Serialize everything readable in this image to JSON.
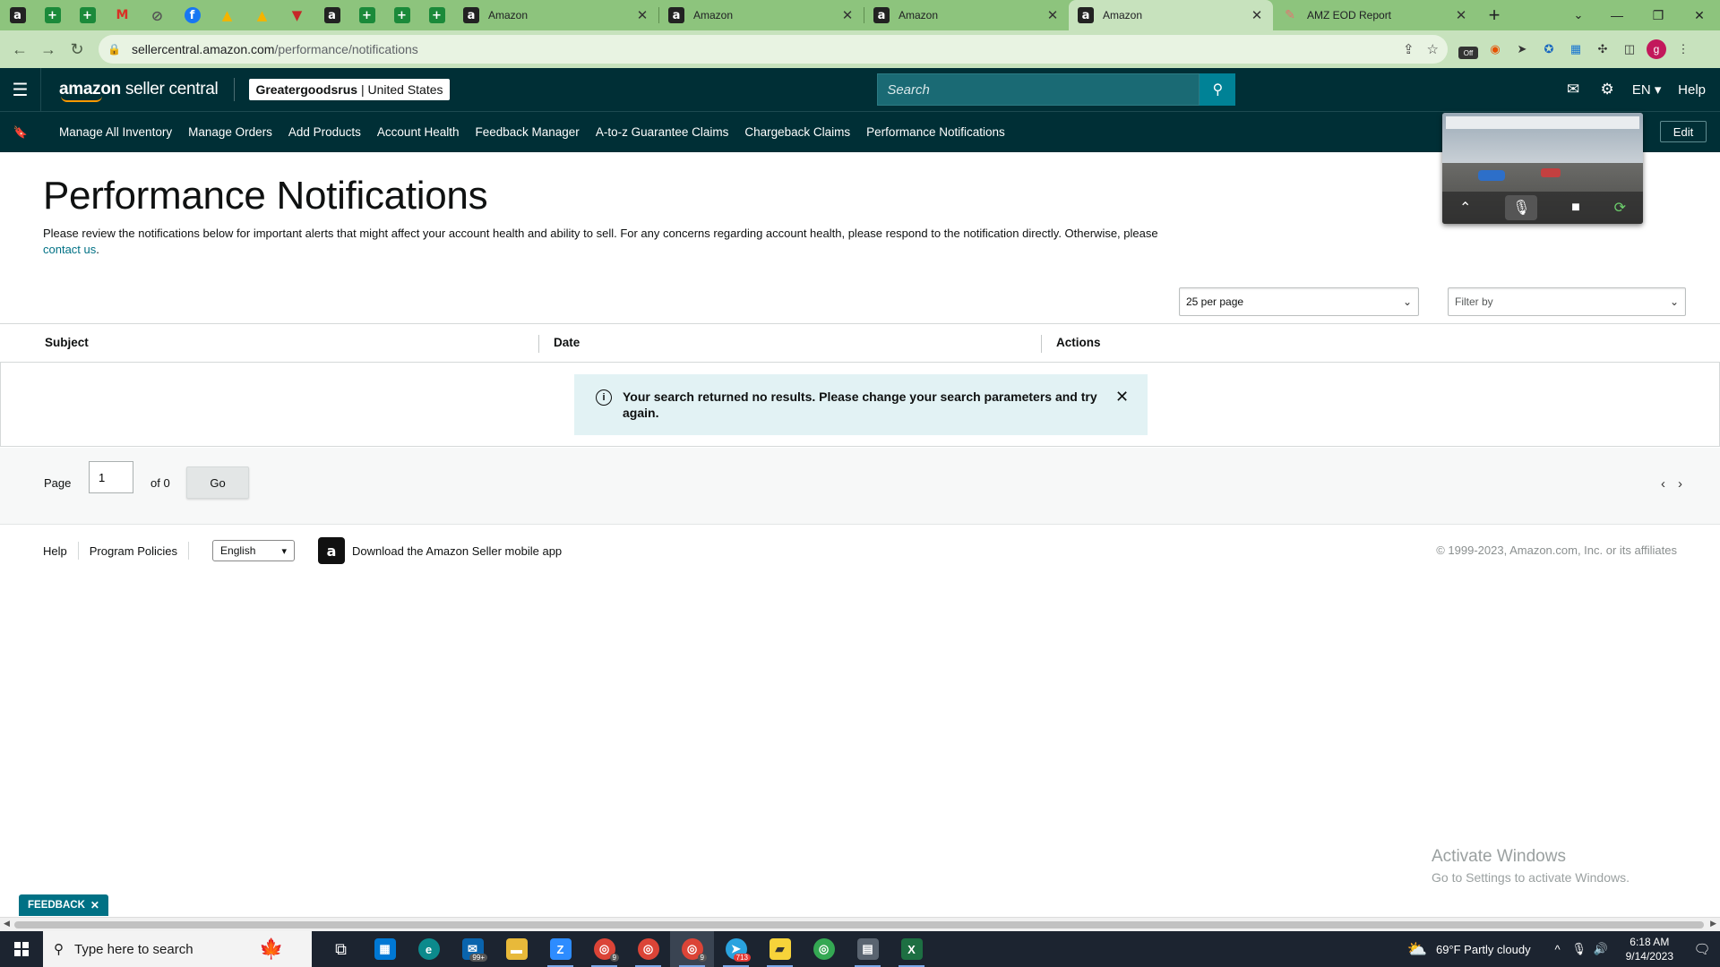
{
  "browser": {
    "pinned_tabs": [
      {
        "icon": "amazon-icon",
        "glyph": "a"
      },
      {
        "icon": "plus-icon",
        "glyph": "+"
      },
      {
        "icon": "plus-icon",
        "glyph": "+"
      },
      {
        "icon": "gmail-icon",
        "glyph": "M"
      },
      {
        "icon": "circle-icon",
        "glyph": "⊘"
      },
      {
        "icon": "facebook-icon",
        "glyph": "f"
      },
      {
        "icon": "drive-icon",
        "glyph": "▲"
      },
      {
        "icon": "drive-icon",
        "glyph": "▲"
      },
      {
        "icon": "red-shield-icon",
        "glyph": "▼"
      },
      {
        "icon": "amazon-icon",
        "glyph": "a"
      },
      {
        "icon": "plus-icon",
        "glyph": "+"
      },
      {
        "icon": "plus-icon",
        "glyph": "+"
      },
      {
        "icon": "plus-icon",
        "glyph": "+"
      }
    ],
    "tabs": [
      {
        "label": "Amazon",
        "active": false
      },
      {
        "label": "Amazon",
        "active": false
      },
      {
        "label": "Amazon",
        "active": false
      },
      {
        "label": "Amazon",
        "active": true
      },
      {
        "label": "AMZ EOD Report",
        "active": false
      }
    ],
    "url_host": "sellercentral.amazon.com",
    "url_path": "/performance/notifications",
    "profile_initial": "g",
    "ext_off_label": "Off"
  },
  "header": {
    "logo_bold": "amazon",
    "logo_rest": " seller central",
    "store_name": "Greatergoodsrus",
    "store_region": "| United States",
    "search_placeholder": "Search",
    "lang": "EN ▾",
    "help": "Help"
  },
  "nav": {
    "items": [
      "Manage All Inventory",
      "Manage Orders",
      "Add Products",
      "Account Health",
      "Feedback Manager",
      "A-to-z Guarantee Claims",
      "Chargeback Claims",
      "Performance Notifications"
    ],
    "edit": "Edit"
  },
  "page": {
    "title": "Performance Notifications",
    "description": "Please review the notifications below for important alerts that might affect your account health and ability to sell. For any concerns regarding account health, please respond to the notification directly. Otherwise, please ",
    "contact_link": "contact us",
    "description_end": ".",
    "per_page": "25 per page",
    "filter_placeholder": "Filter by",
    "columns": [
      "Subject",
      "Date",
      "Actions"
    ],
    "empty_message": "Your search returned no results. Please change your search parameters and try again.",
    "pager": {
      "page_label": "Page",
      "page_value": "1",
      "of_label": "of 0",
      "go": "Go"
    }
  },
  "footer": {
    "help": "Help",
    "program_policies": "Program Policies",
    "language": "English",
    "app_text": "Download the Amazon Seller mobile app",
    "copyright": "© 1999-2023, Amazon.com, Inc. or its affiliates"
  },
  "watermark": {
    "line1": "Activate Windows",
    "line2": "Go to Settings to activate Windows."
  },
  "feedback_label": "FEEDBACK",
  "taskbar": {
    "search_placeholder": "Type here to search",
    "mail_badge": "99+",
    "chrome_badge_1": "9",
    "chrome_badge_3": "9",
    "telegram_badge": "713",
    "weather": "69°F  Partly cloudy",
    "time": "6:18 AM",
    "date": "9/14/2023"
  },
  "colors": {
    "header_bg": "#002f36",
    "link": "#007185",
    "alert_bg": "#e2f2f4",
    "tabstrip": "#8dc47d"
  }
}
